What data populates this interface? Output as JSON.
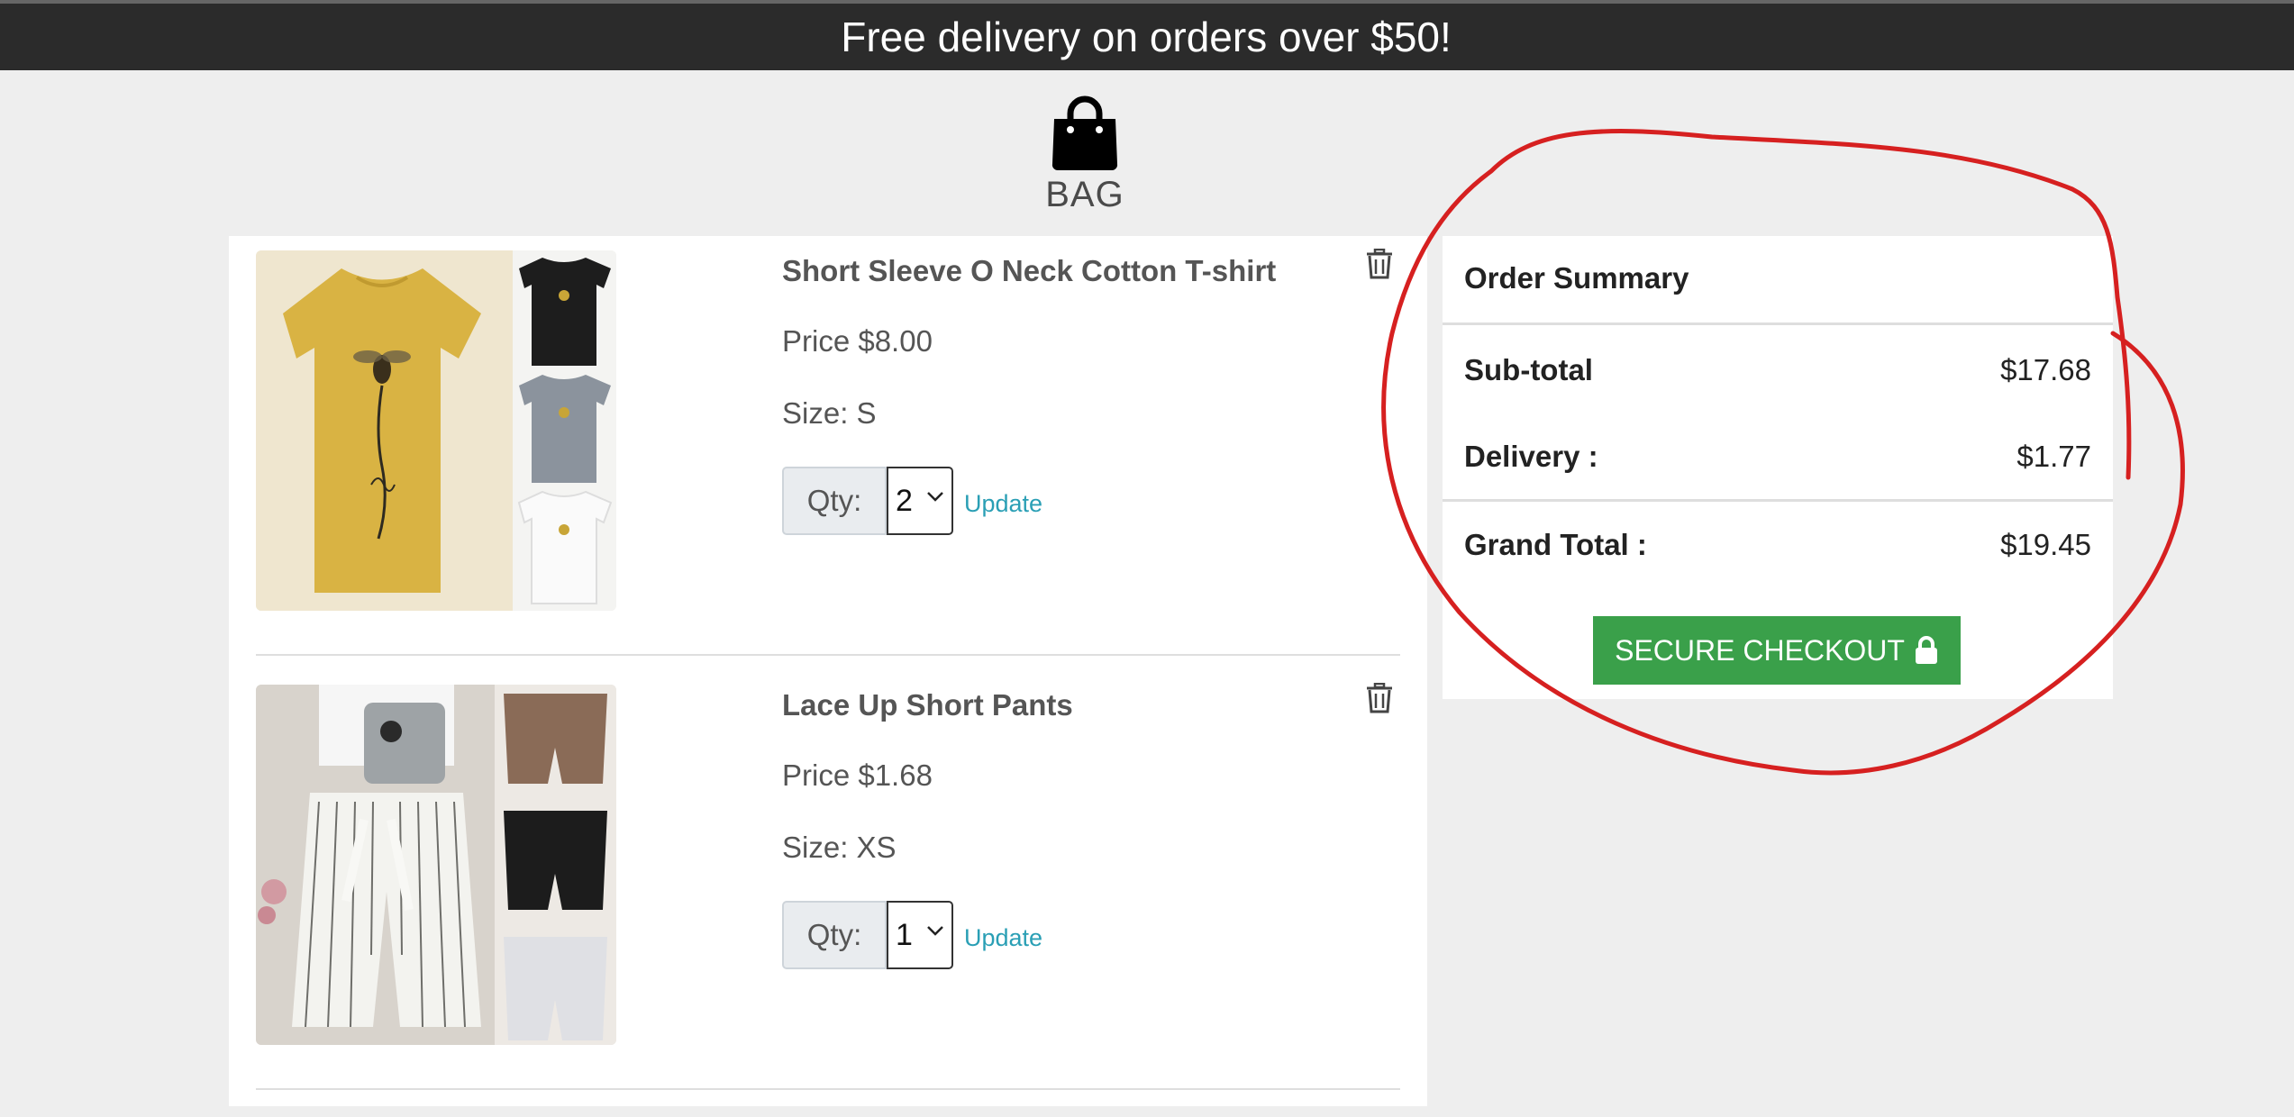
{
  "banner": {
    "text": "Free delivery on orders over $50!"
  },
  "bag": {
    "label": "BAG",
    "icon": "shopping-bag-icon"
  },
  "cart": {
    "items": [
      {
        "title": "Short Sleeve O Neck Cotton T-shirt",
        "price": "Price $8.00",
        "size": "Size: S",
        "qty_label": "Qty:",
        "qty_value": "2",
        "update_label": "Update"
      },
      {
        "title": "Lace Up Short Pants",
        "price": "Price $1.68",
        "size": "Size: XS",
        "qty_label": "Qty:",
        "qty_value": "1",
        "update_label": "Update"
      }
    ]
  },
  "summary": {
    "title": "Order Summary",
    "subtotal_label": "Sub-total",
    "subtotal_value": "$17.68",
    "delivery_label": "Delivery :",
    "delivery_value": "$1.77",
    "grand_total_label": "Grand Total :",
    "grand_total_value": "$19.45",
    "checkout_label": "SECURE CHECKOUT"
  },
  "colors": {
    "banner_bg": "#2b2b2b",
    "checkout_green": "#3aa04a",
    "link_teal": "#2a9fb5",
    "annotation_red": "#d62020"
  }
}
